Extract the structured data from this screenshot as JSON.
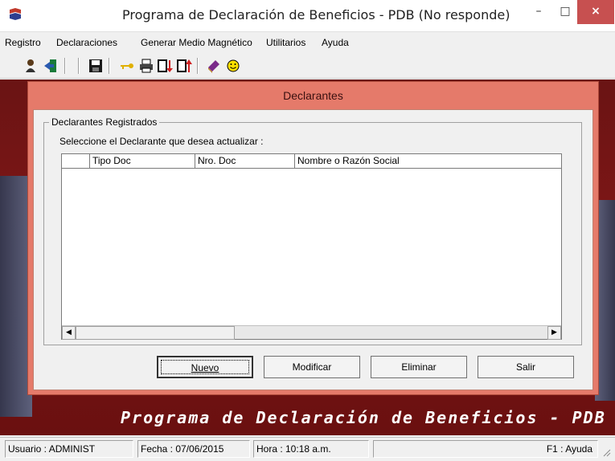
{
  "window": {
    "title": "Programa de Declaración de Beneficios - PDB (No responde)",
    "minimize": "–",
    "maximize": "□",
    "close": "×"
  },
  "menu": {
    "items": [
      "Registro",
      "Declaraciones",
      "Generar Medio Magnético",
      "Utilitarios",
      "Ayuda"
    ]
  },
  "toolbar": {
    "icons": [
      "user-icon",
      "exit-door-icon",
      "save-icon",
      "key-icon",
      "print-icon",
      "import-icon",
      "export-icon",
      "book-icon",
      "smiley-icon"
    ]
  },
  "dialog": {
    "title": "Declarantes",
    "group_title": "Declarantes Registrados",
    "instruction": "Seleccione el Declarante que desea actualizar :",
    "columns": [
      "",
      "Tipo Doc",
      "Nro. Doc",
      "Nombre o Razón Social"
    ],
    "rows": [],
    "buttons": {
      "nuevo": "Nuevo",
      "modificar": "Modificar",
      "eliminar": "Eliminar",
      "salir": "Salir"
    }
  },
  "background_banner": "Programa de Declaración de Beneficios - PDB",
  "status": {
    "usuario": "Usuario : ADMINIST",
    "fecha": "Fecha : 07/06/2015",
    "hora": "Hora : 10:18 a.m.",
    "ayuda": "F1 : Ayuda"
  },
  "colors": {
    "dialog_frame": "#e57a6a",
    "background": "#7d1616",
    "close_button": "#c75050"
  }
}
